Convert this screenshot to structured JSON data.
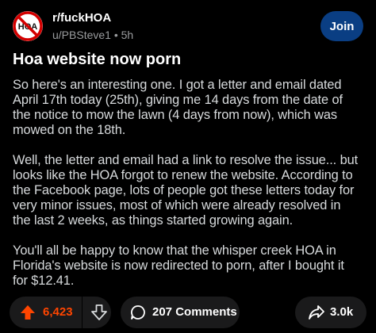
{
  "header": {
    "subreddit": "r/fuckHOA",
    "author": "u/PBSteve1",
    "separator": "•",
    "age": "5h",
    "join_label": "Join",
    "subreddit_icon_text": "HOA"
  },
  "post": {
    "title": "Hoa website now porn",
    "paragraphs": [
      {
        "lines": [
          "So here's an interesting one.  I got a letter and email dated",
          "April 17th today (25th), giving me 14 days from the date of",
          "the notice to mow the lawn (4 days from now), which was",
          "mowed on the 18th."
        ]
      },
      {
        "lines": [
          "Well, the letter and email had a link to resolve the issue... but",
          "looks like the HOA forgot to renew the website. According to",
          "the Facebook page, lots of people got these letters today for",
          "very minor issues, most of which were already resolved in",
          "the last 2 weeks, as things started growing again."
        ]
      },
      {
        "lines": [
          "You'll all be happy to know that the whisper creek HOA in",
          "Florida's website is now redirected to porn, after I bought it",
          "for $12.41."
        ]
      }
    ]
  },
  "actions": {
    "score": "6,423",
    "comments_label": "207 Comments",
    "share_label": "3.0k",
    "upvote_icon": "upvote-arrow-icon",
    "downvote_icon": "downvote-arrow-icon",
    "comment_icon": "comment-bubble-icon",
    "share_icon": "share-arrow-icon"
  },
  "colors": {
    "background": "#000000",
    "text": "#d7dadc",
    "muted": "#9a9c9e",
    "upvote_active": "#ff4500",
    "join_button": "#0a3e83",
    "pill": "#1a1a1b"
  }
}
